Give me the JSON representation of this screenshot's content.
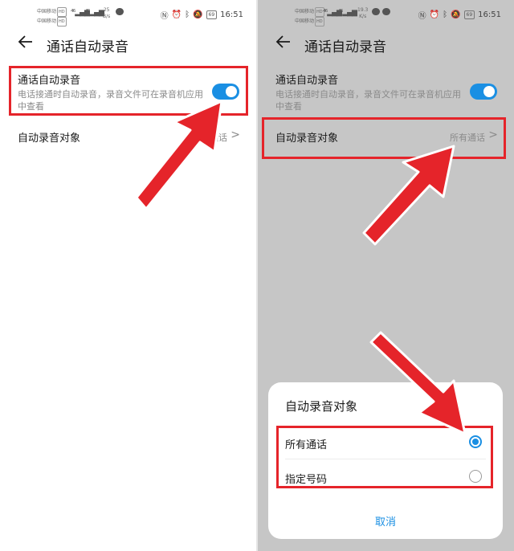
{
  "left_panel": {
    "status": {
      "carrier_1": "中国移动",
      "carrier_2": "中国移动",
      "hd": "HD",
      "speed_value": "25",
      "speed_unit": "B/s",
      "battery": "69",
      "time": "16:51"
    },
    "header": {
      "title": "通话自动录音"
    },
    "auto_record": {
      "title": "通话自动录音",
      "description": "电话接通时自动录音，录音文件可在录音机应用中查看",
      "enabled": true
    },
    "record_target": {
      "label": "自动录音对象",
      "value": "所有通话"
    }
  },
  "right_panel": {
    "status": {
      "carrier_1": "中国移动",
      "carrier_2": "中国移动",
      "hd": "HD",
      "speed_value": "19.3",
      "speed_unit": "K/s",
      "battery": "69",
      "time": "16:51"
    },
    "header": {
      "title": "通话自动录音"
    },
    "auto_record": {
      "title": "通话自动录音",
      "description": "电话接通时自动录音，录音文件可在录音机应用中查看",
      "enabled": true
    },
    "record_target": {
      "label": "自动录音对象",
      "value": "所有通话"
    },
    "dialog": {
      "title": "自动录音对象",
      "options": [
        {
          "label": "所有通话",
          "selected": true
        },
        {
          "label": "指定号码",
          "selected": false
        }
      ],
      "cancel": "取消"
    }
  },
  "colors": {
    "accent": "#1a8fe3",
    "annotation_red": "#e5242a",
    "dimmed_background": "#c6c6c6"
  }
}
